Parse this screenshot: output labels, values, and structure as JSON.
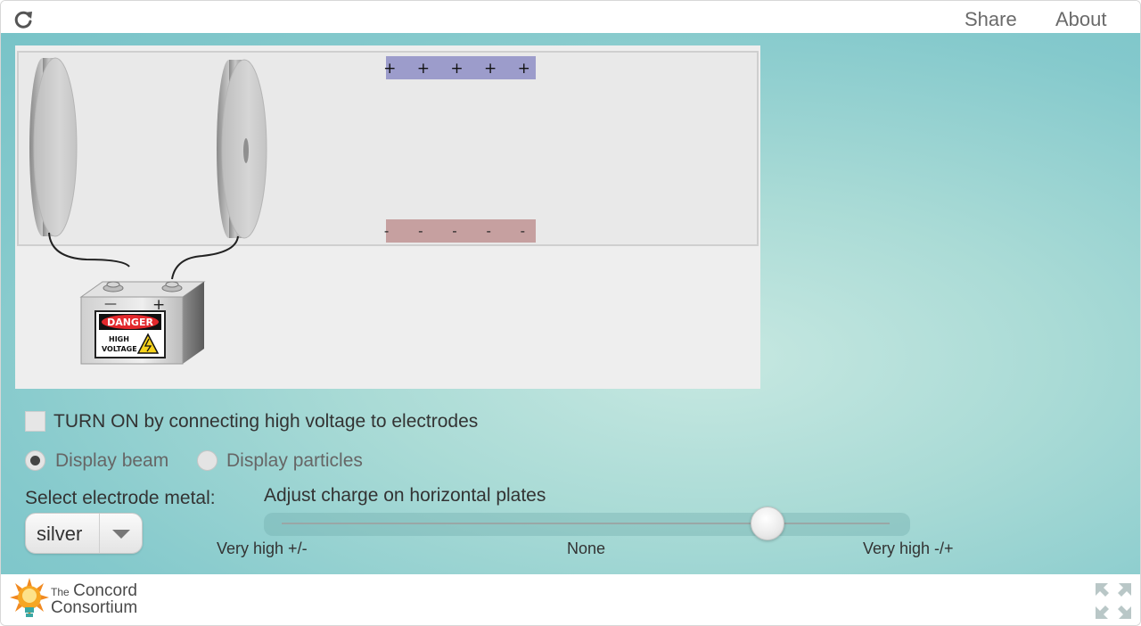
{
  "topbar": {
    "share_label": "Share",
    "about_label": "About"
  },
  "simulation": {
    "top_plate_signs": "+ + + + +",
    "bottom_plate_signs": "- - - - -",
    "battery": {
      "minus": "—",
      "plus": "+",
      "danger": "DANGER",
      "warning_line1": "HIGH",
      "warning_line2": "VOLTAGE"
    }
  },
  "controls": {
    "turn_on_label": "TURN ON by connecting high voltage to electrodes",
    "turn_on_checked": false,
    "display_beam_label": "Display beam",
    "display_particles_label": "Display particles",
    "display_selected": "beam",
    "electrode_label": "Select electrode metal:",
    "electrode_value": "silver",
    "slider": {
      "title": "Adjust charge on horizontal plates",
      "left_label": "Very high +/-",
      "middle_label": "None",
      "right_label": "Very high -/+",
      "value_fraction": 0.79
    }
  },
  "footer": {
    "logo_small": "The",
    "logo_line1": "Concord",
    "logo_line2": "Consortium"
  },
  "colors": {
    "positive_plate": "#9c9ccb",
    "negative_plate": "#c6a0a0",
    "danger_red": "#e3282c",
    "background_teal": "#84c9cc"
  }
}
